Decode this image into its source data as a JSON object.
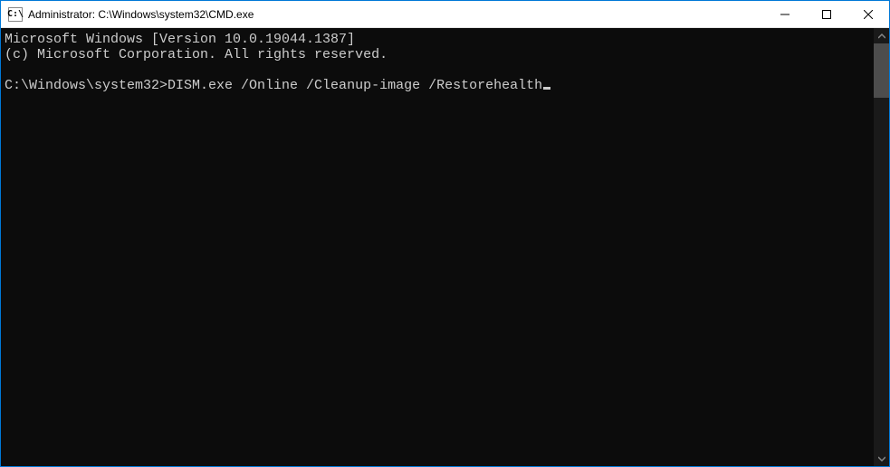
{
  "window": {
    "title": "Administrator: C:\\Windows\\system32\\CMD.exe",
    "icon_glyph": "C:\\"
  },
  "terminal": {
    "banner_line1": "Microsoft Windows [Version 10.0.19044.1387]",
    "banner_line2": "(c) Microsoft Corporation. All rights reserved.",
    "prompt": "C:\\Windows\\system32>",
    "command": "DISM.exe /Online /Cleanup-image /Restorehealth"
  }
}
